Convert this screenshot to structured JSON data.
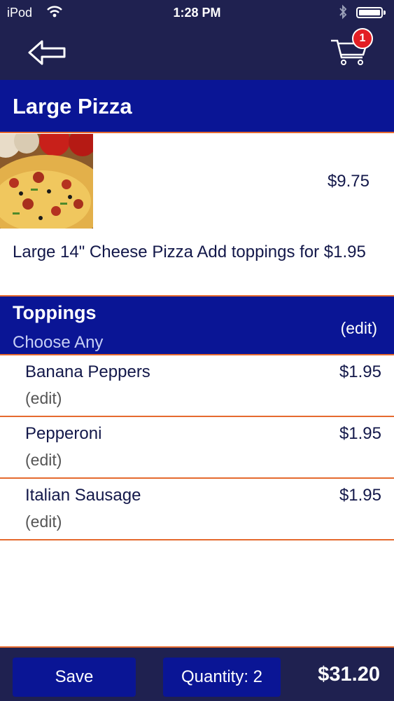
{
  "status_bar": {
    "carrier": "iPod",
    "time": "1:28 PM",
    "wifi_icon": "wifi-icon",
    "bluetooth_icon": "bluetooth-icon",
    "battery_icon": "battery-icon"
  },
  "nav": {
    "back_icon": "back-arrow-icon",
    "cart_icon": "cart-icon",
    "cart_count": "1"
  },
  "product": {
    "title": "Large Pizza",
    "price": "$9.75",
    "description": "Large 14\" Cheese Pizza Add toppings for $1.95",
    "image": "pizza-photo"
  },
  "toppings": {
    "title": "Toppings",
    "subtitle": "Choose Any",
    "edit_label": "(edit)",
    "items": [
      {
        "name": "Banana Peppers",
        "price": "$1.95",
        "edit": "(edit)"
      },
      {
        "name": "Pepperoni",
        "price": "$1.95",
        "edit": "(edit)"
      },
      {
        "name": "Italian Sausage",
        "price": "$1.95",
        "edit": "(edit)"
      }
    ]
  },
  "footer": {
    "save_label": "Save",
    "quantity_label": "Quantity: 2",
    "total": "$31.20"
  },
  "colors": {
    "nav_bg": "#1f2150",
    "header_bg": "#0a1595",
    "divider": "#e56a2f",
    "badge": "#e31e24",
    "text": "#13184a"
  }
}
